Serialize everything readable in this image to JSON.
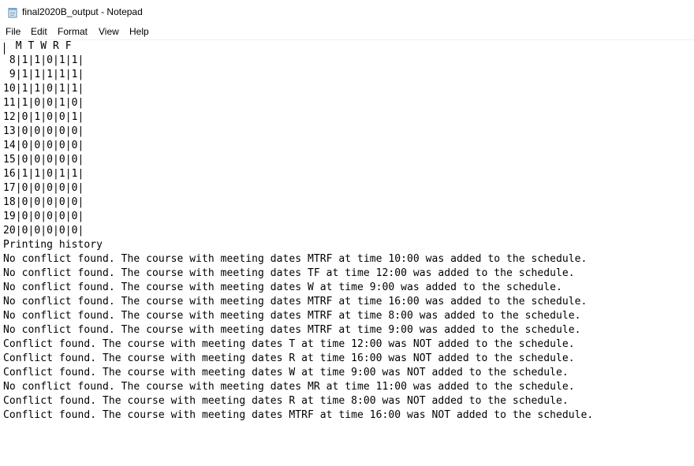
{
  "window": {
    "title": "final2020B_output - Notepad",
    "icon": "notepad-icon"
  },
  "menu": {
    "items": [
      "File",
      "Edit",
      "Format",
      "View",
      "Help"
    ]
  },
  "document": {
    "lines": [
      "  M T W R F",
      " 8|1|1|0|1|1|",
      " 9|1|1|1|1|1|",
      "10|1|1|0|1|1|",
      "11|1|0|0|1|0|",
      "12|0|1|0|0|1|",
      "13|0|0|0|0|0|",
      "14|0|0|0|0|0|",
      "15|0|0|0|0|0|",
      "16|1|1|0|1|1|",
      "17|0|0|0|0|0|",
      "18|0|0|0|0|0|",
      "19|0|0|0|0|0|",
      "20|0|0|0|0|0|",
      "Printing history",
      "No conflict found. The course with meeting dates MTRF at time 10:00 was added to the schedule.",
      "No conflict found. The course with meeting dates TF at time 12:00 was added to the schedule.",
      "No conflict found. The course with meeting dates W at time 9:00 was added to the schedule.",
      "No conflict found. The course with meeting dates MTRF at time 16:00 was added to the schedule.",
      "No conflict found. The course with meeting dates MTRF at time 8:00 was added to the schedule.",
      "No conflict found. The course with meeting dates MTRF at time 9:00 was added to the schedule.",
      "Conflict found. The course with meeting dates T at time 12:00 was NOT added to the schedule.",
      "Conflict found. The course with meeting dates R at time 16:00 was NOT added to the schedule.",
      "Conflict found. The course with meeting dates W at time 9:00 was NOT added to the schedule.",
      "No conflict found. The course with meeting dates MR at time 11:00 was added to the schedule.",
      "Conflict found. The course with meeting dates R at time 8:00 was NOT added to the schedule.",
      "Conflict found. The course with meeting dates MTRF at time 16:00 was NOT added to the schedule."
    ]
  }
}
